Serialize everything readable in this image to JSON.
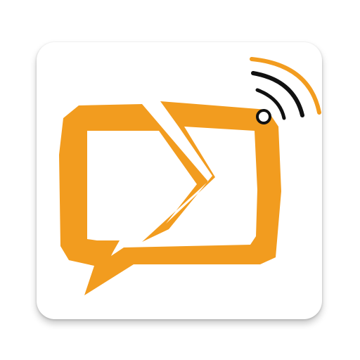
{
  "app_icon": {
    "icon": "chat-tv-broadcast-icon",
    "colors": {
      "primary": "#f29c1f",
      "signal_dark": "#111111",
      "tile": "#ffffff"
    }
  }
}
